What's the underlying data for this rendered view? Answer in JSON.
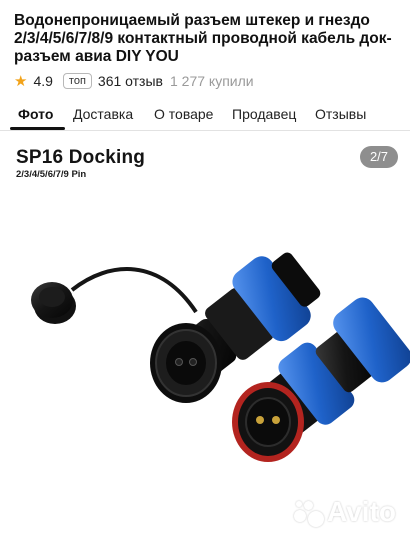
{
  "product": {
    "title": "Водонепроницаемый разъем штекер и гнездо 2/3/4/5/6/7/8/9 контактный проводной кабель док-разъем авиа DIY YOU",
    "rating": "4.9",
    "badge": "топ",
    "reviews": "361 отзыв",
    "bought": "1 277 купили"
  },
  "tabs": [
    {
      "label": "Фото",
      "active": true
    },
    {
      "label": "Доставка",
      "active": false
    },
    {
      "label": "О товаре",
      "active": false
    },
    {
      "label": "Продавец",
      "active": false
    },
    {
      "label": "Отзывы",
      "active": false
    }
  ],
  "photo": {
    "heading": "SP16 Docking",
    "subheading": "2/3/4/5/6/7/9 Pin",
    "counter": "2/7",
    "watermark": "Avito"
  },
  "colors": {
    "star": "#f2a31a",
    "connector_blue": "#1f62c9",
    "connector_body": "#121212"
  }
}
